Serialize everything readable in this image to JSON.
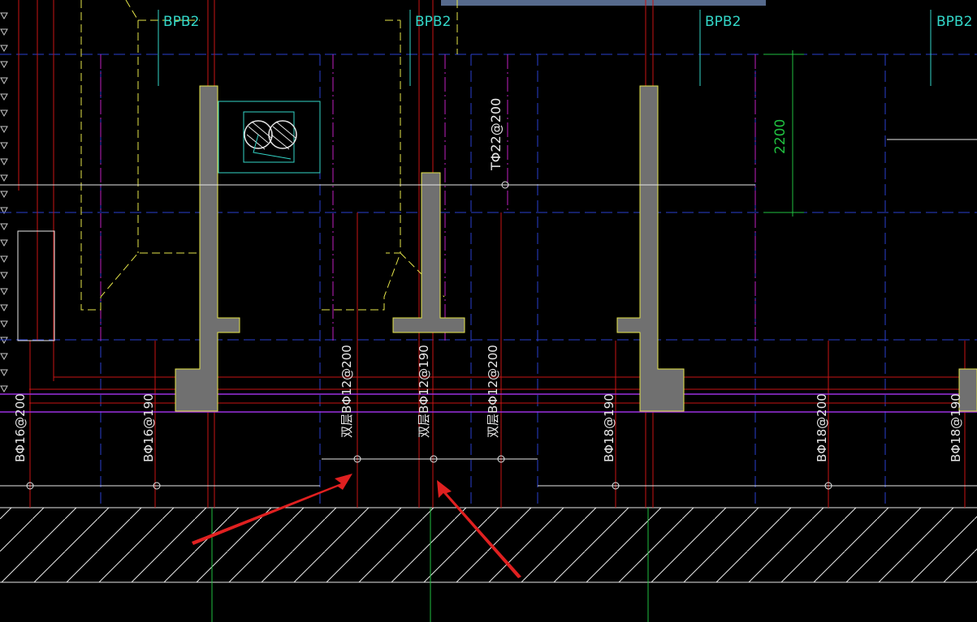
{
  "labels": {
    "bpb": [
      "BPB2",
      "BPB2",
      "BPB2",
      "BPB2"
    ],
    "dim_2200": "2200",
    "t_rebar": "TΦ22@200",
    "rebars": [
      "BΦ16@200",
      "BΦ16@190",
      "双层BΦ12@200",
      "双层BΦ12@190",
      "双层BΦ12@200",
      "BΦ18@190",
      "BΦ18@200",
      "BΦ18@190"
    ]
  },
  "colors": {
    "background": "#000000",
    "cyan": "#33d6c8",
    "yellow": "#e6e64a",
    "red": "#c81414",
    "blue": "#2a3fd0",
    "magenta": "#c020c0",
    "purple": "#9a30e0",
    "white": "#e8e8e8",
    "green": "#20c040",
    "gray_fill": "#707070",
    "arrow": "#e02020",
    "topbar": "#566a8c"
  },
  "icons": [
    "pile-symbol-icon",
    "annotation-arrow-icon"
  ]
}
